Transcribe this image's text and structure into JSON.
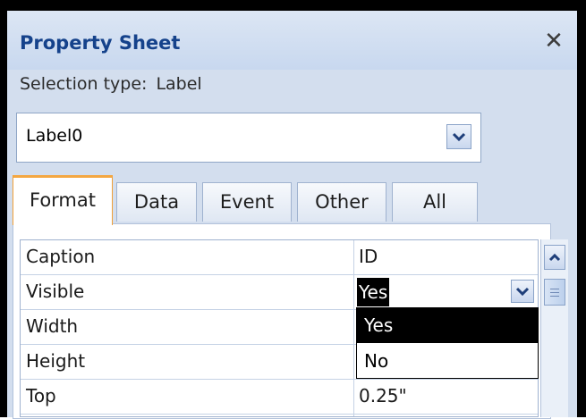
{
  "panel": {
    "title": "Property Sheet",
    "close_glyph": "✕",
    "selection_type_label": "Selection type:",
    "selection_type_value": "Label",
    "object_selector_value": "Label0"
  },
  "tabs": [
    {
      "label": "Format",
      "active": true
    },
    {
      "label": "Data",
      "active": false
    },
    {
      "label": "Event",
      "active": false
    },
    {
      "label": "Other",
      "active": false
    },
    {
      "label": "All",
      "active": false
    }
  ],
  "properties": [
    {
      "name": "Caption",
      "value": "ID"
    },
    {
      "name": "Visible",
      "value": "Yes"
    },
    {
      "name": "Width",
      "value": ""
    },
    {
      "name": "Height",
      "value": ""
    },
    {
      "name": "Top",
      "value": "0.25\""
    }
  ],
  "visible_dropdown": {
    "options": [
      "Yes",
      "No"
    ],
    "highlighted": "Yes"
  },
  "icons": {
    "close": "close-icon",
    "combo_arrow": "chevron-down-icon",
    "scroll_up": "chevron-up-icon"
  },
  "colors": {
    "title_text": "#15428b",
    "panel_bg": "#d3deee",
    "active_tab_accent": "#f4a742",
    "selection_bg": "#000000"
  }
}
